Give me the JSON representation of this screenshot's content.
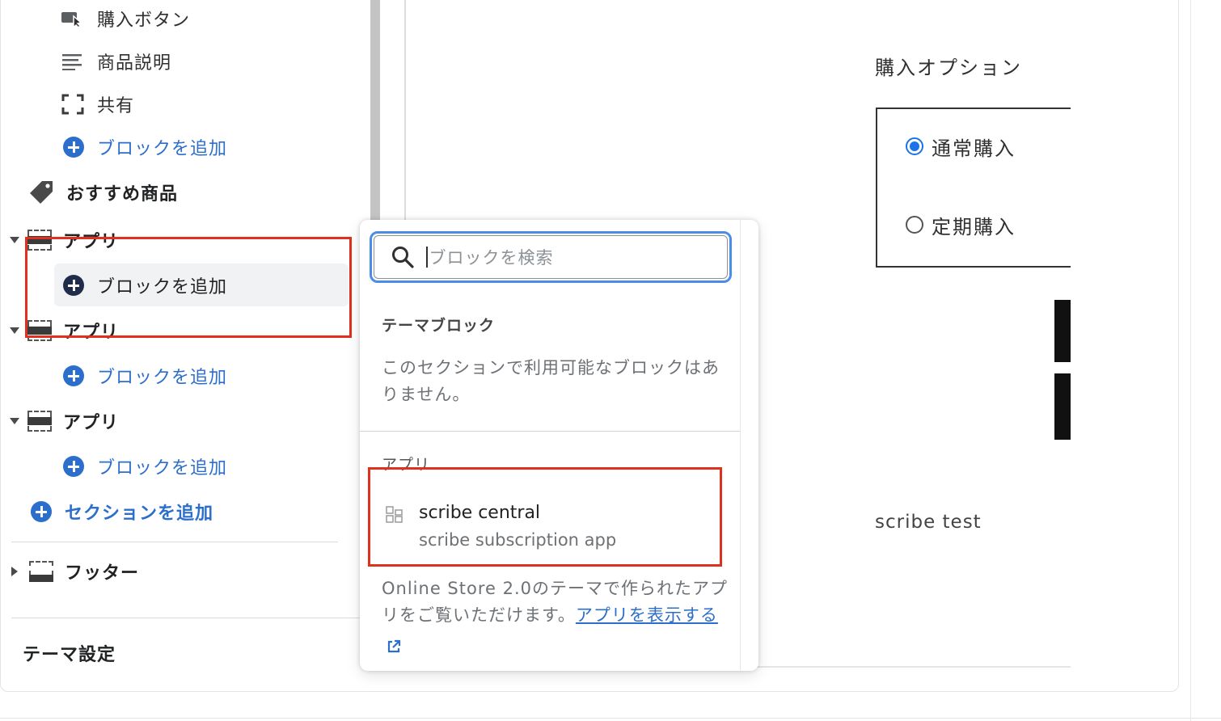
{
  "sidebar": {
    "items": [
      {
        "label": "購入ボタン"
      },
      {
        "label": "商品説明"
      },
      {
        "label": "共有"
      },
      {
        "label": "ブロックを追加"
      },
      {
        "label": "おすすめ商品"
      },
      {
        "label": "アプリ"
      },
      {
        "label": "ブロックを追加"
      },
      {
        "label": "アプリ"
      },
      {
        "label": "ブロックを追加"
      },
      {
        "label": "アプリ"
      },
      {
        "label": "ブロックを追加"
      },
      {
        "label": "セクションを追加"
      },
      {
        "label": "フッター"
      },
      {
        "label": "テーマ設定"
      }
    ]
  },
  "popup": {
    "search_placeholder": "ブロックを検索",
    "theme_blocks_heading": "テーマブロック",
    "theme_blocks_empty": "このセクションで利用可能なブロックはありません。",
    "apps_heading": "アプリ",
    "app": {
      "name": "scribe central",
      "subtitle": "scribe subscription app"
    },
    "footer_text": "Online Store 2.0のテーマで作られたアプリをご覧いただけます。",
    "footer_link": "アプリを表示する"
  },
  "preview": {
    "options_title": "購入オプション",
    "option_regular": "通常購入",
    "option_subscription": "定期購入",
    "product_text": "scribe test"
  },
  "colors": {
    "accent": "#2c6ecb",
    "highlight": "#e0301e",
    "focus": "#4a8de8"
  }
}
